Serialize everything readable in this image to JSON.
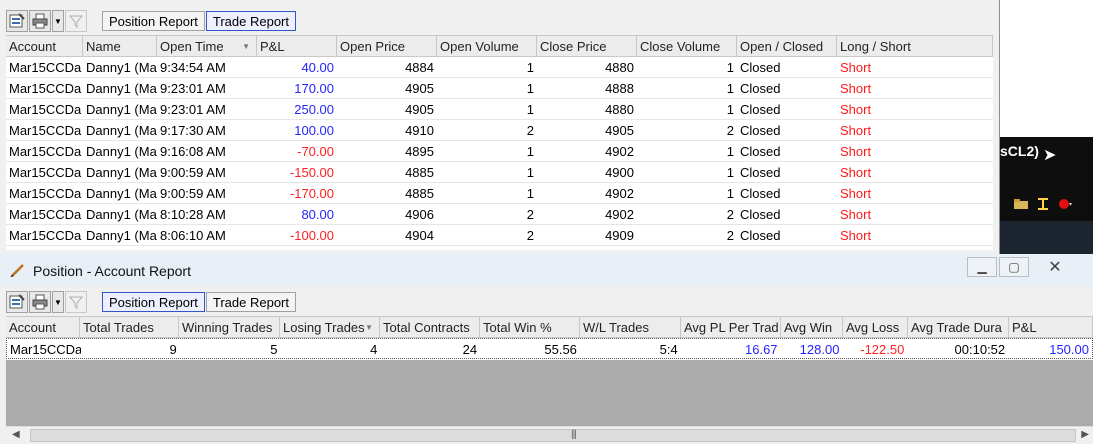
{
  "top_report": {
    "tabs": [
      "Position Report",
      "Trade Report"
    ],
    "active_tab": 1,
    "columns": [
      "Account",
      "Name",
      "Open Time",
      "P&L",
      "Open Price",
      "Open Volume",
      "Close Price",
      "Close Volume",
      "Open / Closed",
      "Long / Short"
    ],
    "rows": [
      [
        "Mar15CCDa",
        "Danny1 (Ma",
        "9:34:54 AM",
        "40.00",
        "4884",
        "1",
        "4880",
        "1",
        "Closed",
        "Short"
      ],
      [
        "Mar15CCDa",
        "Danny1 (Ma",
        "9:23:01 AM",
        "170.00",
        "4905",
        "1",
        "4888",
        "1",
        "Closed",
        "Short"
      ],
      [
        "Mar15CCDa",
        "Danny1 (Ma",
        "9:23:01 AM",
        "250.00",
        "4905",
        "1",
        "4880",
        "1",
        "Closed",
        "Short"
      ],
      [
        "Mar15CCDa",
        "Danny1 (Ma",
        "9:17:30 AM",
        "100.00",
        "4910",
        "2",
        "4905",
        "2",
        "Closed",
        "Short"
      ],
      [
        "Mar15CCDa",
        "Danny1 (Ma",
        "9:16:08 AM",
        "-70.00",
        "4895",
        "1",
        "4902",
        "1",
        "Closed",
        "Short"
      ],
      [
        "Mar15CCDa",
        "Danny1 (Ma",
        "9:00:59 AM",
        "-150.00",
        "4885",
        "1",
        "4900",
        "1",
        "Closed",
        "Short"
      ],
      [
        "Mar15CCDa",
        "Danny1 (Ma",
        "9:00:59 AM",
        "-170.00",
        "4885",
        "1",
        "4902",
        "1",
        "Closed",
        "Short"
      ],
      [
        "Mar15CCDa",
        "Danny1 (Ma",
        "8:10:28 AM",
        "80.00",
        "4906",
        "2",
        "4902",
        "2",
        "Closed",
        "Short"
      ],
      [
        "Mar15CCDa",
        "Danny1 (Ma",
        "8:06:10 AM",
        "-100.00",
        "4904",
        "2",
        "4909",
        "2",
        "Closed",
        "Short"
      ]
    ]
  },
  "side_panel": {
    "label": "sCL2)"
  },
  "account_window": {
    "title": "Position - Account Report",
    "tabs": [
      "Position Report",
      "Trade Report"
    ],
    "active_tab": 0,
    "columns": [
      "Account",
      "Total Trades",
      "Winning Trades",
      "Losing Trades",
      "Total Contracts",
      "Total Win %",
      "W/L Trades",
      "Avg PL Per Trad",
      "Avg Win",
      "Avg Loss",
      "Avg Trade Dura",
      "P&L"
    ],
    "rows": [
      [
        "Mar15CCDa",
        "9",
        "5",
        "4",
        "24",
        "55.56",
        "5:4",
        "16.67",
        "128.00",
        "-122.50",
        "00:10:52",
        "150.00"
      ]
    ]
  },
  "colors": {
    "positive": "#2424ff",
    "negative": "#ff2020",
    "short": "#ff1a1a",
    "active_tab_border": "#3355cc"
  }
}
